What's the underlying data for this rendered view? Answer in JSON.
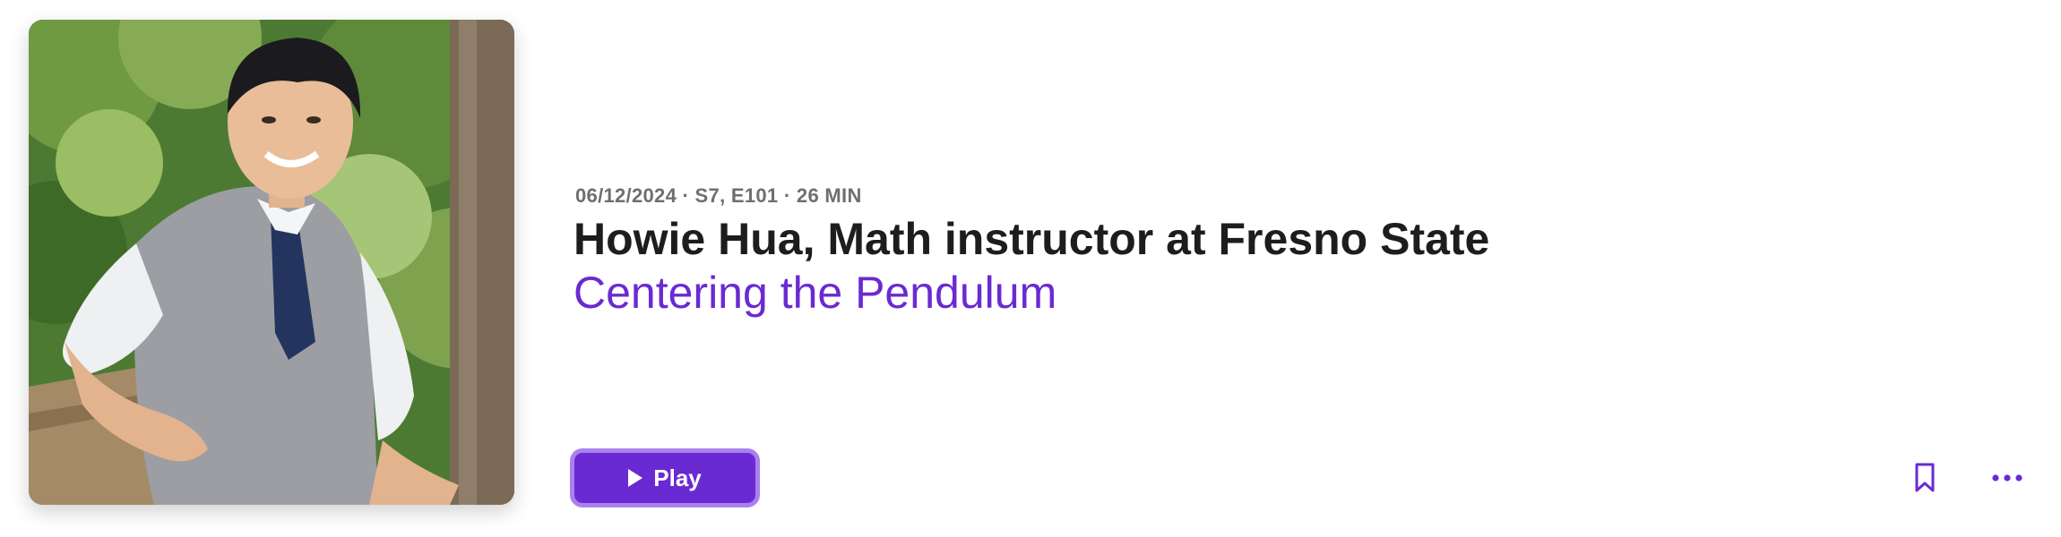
{
  "episode": {
    "meta": "06/12/2024 · S7, E101 · 26 MIN",
    "title": "Howie Hua, Math instructor at Fresno State",
    "show_name": "Centering the Pendulum"
  },
  "actions": {
    "play_label": "Play",
    "bookmark_icon": "bookmark-icon",
    "more_icon": "ellipsis-icon"
  },
  "colors": {
    "accent": "#6a2ad2",
    "accent_border": "#a981ee",
    "title_text": "#1d1d1f",
    "meta_text": "#6e6e73"
  }
}
